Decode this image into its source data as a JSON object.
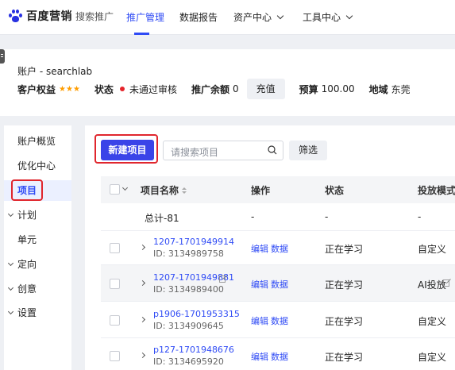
{
  "header": {
    "logo_text": "百度营销",
    "logo_sub": "搜索推广",
    "nav": [
      {
        "label": "推广管理",
        "active": true
      },
      {
        "label": "数据报告",
        "active": false
      },
      {
        "label": "资产中心",
        "active": false
      },
      {
        "label": "工具中心",
        "active": false
      }
    ]
  },
  "account": {
    "title": "账户 - searchlab",
    "rights_label": "客户权益",
    "stars": "★★★",
    "status_label": "状态",
    "status_value": "未通过审核",
    "balance_label": "推广余额",
    "balance_value": "0",
    "recharge_button": "充值",
    "budget_label": "预算",
    "budget_value": "100.00",
    "region_label": "地域",
    "region_value": "东莞"
  },
  "sidebar": {
    "items": [
      {
        "label": "账户概览",
        "expandable": false,
        "active": false
      },
      {
        "label": "优化中心",
        "expandable": false,
        "active": false
      },
      {
        "label": "项目",
        "expandable": false,
        "active": true
      },
      {
        "label": "计划",
        "expandable": true,
        "active": false
      },
      {
        "label": "单元",
        "expandable": false,
        "active": false
      },
      {
        "label": "定向",
        "expandable": true,
        "active": false
      },
      {
        "label": "创意",
        "expandable": true,
        "active": false
      },
      {
        "label": "设置",
        "expandable": true,
        "active": false
      }
    ]
  },
  "toolbar": {
    "new_project_button": "新建项目",
    "search_placeholder": "请搜索项目",
    "filter_button": "筛选"
  },
  "table": {
    "columns": [
      "项目名称",
      "操作",
      "状态",
      "投放模式"
    ],
    "total_row": {
      "name": "总计-81",
      "action": "-",
      "status": "-",
      "mode": "-"
    },
    "edit_label": "编辑",
    "data_label": "数据",
    "rows": [
      {
        "name": "1207-1701949914",
        "id": "ID: 3134989758",
        "status": "正在学习",
        "mode": "自定义",
        "highlight": false
      },
      {
        "name": "1207-1701949881",
        "id": "ID: 3134989400",
        "status": "正在学习",
        "mode": "AI投放",
        "highlight": true
      },
      {
        "name": "p1906-1701953315",
        "id": "ID: 3134909645",
        "status": "正在学习",
        "mode": "自定义",
        "highlight": false
      },
      {
        "name": "p127-1701948676",
        "id": "ID: 3134695920",
        "status": "正在学习",
        "mode": "自定义",
        "highlight": false
      }
    ]
  },
  "colors": {
    "accent": "#2f4bf5",
    "primary_button": "#3a44e8",
    "annotation_red": "#e0262d",
    "star": "#ff9d00",
    "status_dot": "#e5242b"
  }
}
